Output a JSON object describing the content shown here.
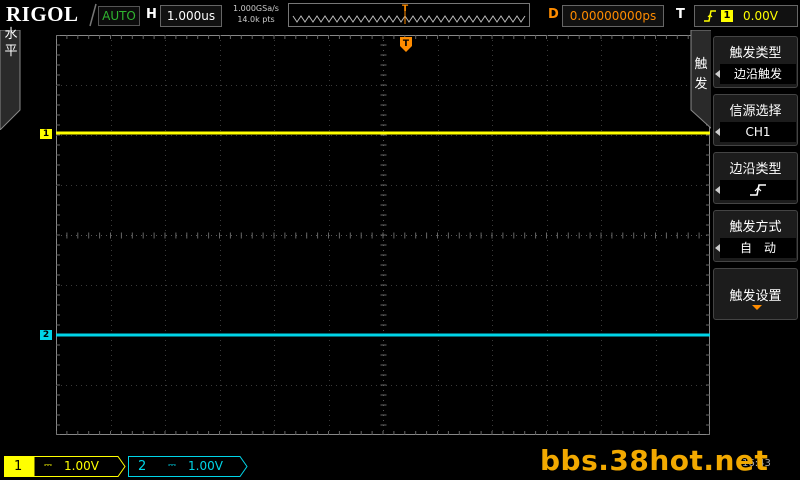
{
  "brand": "RIGOL",
  "top": {
    "run_status": "AUTO",
    "horizontal_label": "H",
    "timebase": "1.000us",
    "sample_rate": "1.000GSa/s",
    "memory_depth": "14.0k pts",
    "trigger_position_marker": "T",
    "delay_label": "D",
    "delay_value": "0.00000000ps",
    "trigger_label": "T",
    "trigger_source_badge": "1",
    "trigger_level": "0.00V"
  },
  "left_tab": {
    "label": "水平"
  },
  "channels": [
    {
      "id": "1",
      "marker": "1",
      "coupling_symbol": "⎓",
      "scale": "1.00V",
      "color": "#ffff00"
    },
    {
      "id": "2",
      "marker": "2",
      "coupling_symbol": "⎓",
      "scale": "1.00V",
      "color": "#00d5e8"
    }
  ],
  "menu": {
    "tab_label": "触发",
    "items": [
      {
        "title": "触发类型",
        "value": "边沿触发",
        "has_arrow": true
      },
      {
        "title": "信源选择",
        "value": "CH1",
        "has_arrow": true
      },
      {
        "title": "边沿类型",
        "value_icon": "rising-edge-icon",
        "has_arrow": true
      },
      {
        "title": "触发方式",
        "value": "自　动",
        "has_arrow": true
      },
      {
        "title": "触发设置",
        "has_submenu": true
      }
    ]
  },
  "watermark": "bbs.38hot.net",
  "bottom_readout": "16:43",
  "colors": {
    "ch1": "#ffff00",
    "ch2": "#00d5e8",
    "accent": "#ff8c00",
    "status_green": "#2fb52f"
  }
}
